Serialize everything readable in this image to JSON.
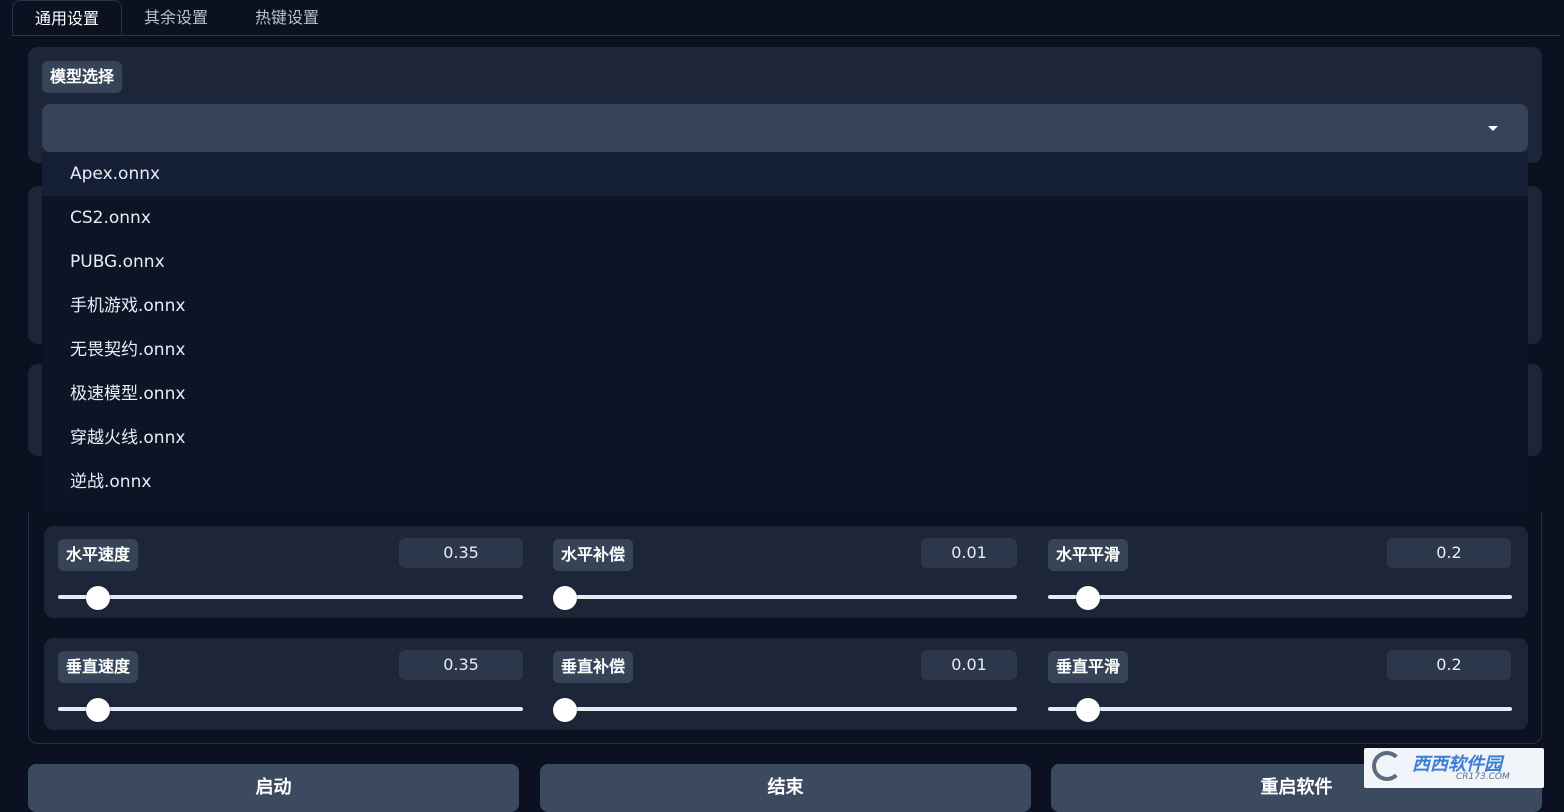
{
  "tabs": [
    "通用设置",
    "其余设置",
    "热键设置"
  ],
  "model": {
    "label": "模型选择",
    "selected": "",
    "options": [
      "Apex.onnx",
      "CS2.onnx",
      "PUBG.onnx",
      "手机游戏.onnx",
      "无畏契约.onnx",
      "极速模型.onnx",
      "穿越火线.onnx",
      "逆战.onnx"
    ],
    "highlighted_index": 0
  },
  "sliders": {
    "h_speed": {
      "label": "水平速度",
      "value": "0.35",
      "fraction": 0.06
    },
    "h_comp": {
      "label": "水平补偿",
      "value": "0.01",
      "fraction": 0.0
    },
    "h_smooth": {
      "label": "水平平滑",
      "value": "0.2",
      "fraction": 0.06
    },
    "v_speed": {
      "label": "垂直速度",
      "value": "0.35",
      "fraction": 0.06
    },
    "v_comp": {
      "label": "垂直补偿",
      "value": "0.01",
      "fraction": 0.0
    },
    "v_smooth": {
      "label": "垂直平滑",
      "value": "0.2",
      "fraction": 0.06
    }
  },
  "buttons": {
    "start": "启动",
    "stop": "结束",
    "restart": "重启软件"
  },
  "watermark": {
    "brand": "西西软件园",
    "sub": "CR173.COM"
  }
}
